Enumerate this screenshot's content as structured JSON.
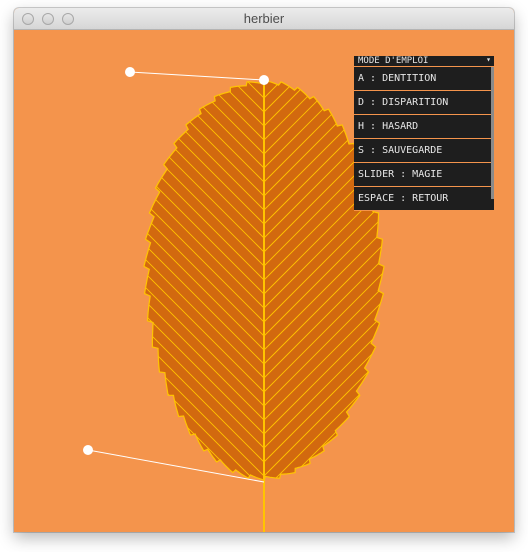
{
  "window": {
    "title": "herbier"
  },
  "colors": {
    "background": "#f4944c",
    "leaf_fill": "#d2690f",
    "leaf_outline": "#ffc400",
    "vein": "#ffc400",
    "handle": "#ffffff",
    "menu_bg": "#1e1e1e",
    "menu_text": "#e6e6e6"
  },
  "menu": {
    "header": "MODE D'EMPLOI",
    "header_icon": "triangle-down-icon",
    "items": [
      {
        "label": "A : DENTITION"
      },
      {
        "label": "D : DISPARITION"
      },
      {
        "label": "H : HASARD"
      },
      {
        "label": "S : SAUVEGARDE"
      },
      {
        "label": "SLIDER : MAGIE"
      },
      {
        "label": "ESPACE : RETOUR"
      }
    ]
  }
}
